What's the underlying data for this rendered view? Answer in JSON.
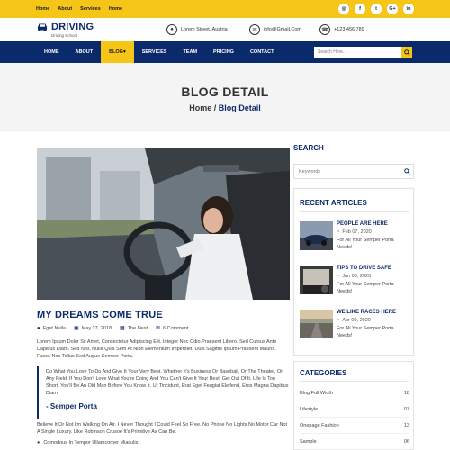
{
  "topbar": {
    "links": [
      "Home",
      "About",
      "Services",
      "Home"
    ],
    "social": [
      {
        "icon": "rss-icon",
        "glyph": "◎"
      },
      {
        "icon": "facebook-icon",
        "glyph": "f"
      },
      {
        "icon": "twitter-icon",
        "glyph": "t"
      },
      {
        "icon": "google-plus-icon",
        "glyph": "G+"
      },
      {
        "icon": "linkedin-icon",
        "glyph": "in"
      }
    ]
  },
  "header": {
    "brand": "DRIVING",
    "tagline": "Driving School",
    "address": "Lorem Street, Austria",
    "email": "info@Gmail.Com",
    "phone": "+123 456 789"
  },
  "nav": {
    "items": [
      "HOME",
      "ABOUT",
      "BLOG▾",
      "SERVICES",
      "TEAM",
      "PRICING",
      "CONTACT"
    ],
    "active_index": 2,
    "search_placeholder": "Search Here..."
  },
  "hero": {
    "title": "BLOG DETAIL",
    "crumb_home": "Home",
    "crumb_sep": " / ",
    "crumb_current": "Blog Detail"
  },
  "post": {
    "title": "MY DREAMS COME TRUE",
    "author": "Eget Nulla",
    "date": "May 27, 2018",
    "category": "The Nest",
    "comments": "6 Comment",
    "intro": "Lorem Ipsum Dolor Sit Amet, Consectetur Adipiscing Elit. Integer Nec Odio.Praesent Libero. Sed Cursus Ante Dapibus Diam. Sed Nisi. Nulla Quis Sem At Nibh Elementum Imperdiet. Duis Sagittis Ipsum.Praesent Mauris. Fusce Nec Tellus Sed Augue Semper Porta.",
    "quote": "Do What You Love To Do And Give It Your Very Best. Whether It's Business Or Baseball, Or The Theater, Or Any Field. If You Don't Love What You're Doing And You Can't Give It Your Best, Get Out Of It. Life Is Too Short. You'll Be An Old Man Before You Know It. Ut Tincidunt, Erat Eget Feugiat Eleifend, Eros Magna Dapibus Diam.",
    "quote_author": "- Semper Porta",
    "body": "Believe It Or Not I'm Walking On Air. I Never Thought I Could Feel So Free. No Phone No Lights No Motor Car Not A Single Luxury. Like Robinson Crusoe It's Primitive As Can Be.",
    "bullet": "Comodous In Tempor Ullamcorper Miaculis."
  },
  "sidebar": {
    "search_title": "SEARCH",
    "search_placeholder": "Keywords",
    "recent_title": "RECENT ARTICLES",
    "articles": [
      {
        "title": "PEOPLE ARE HERE",
        "date": "Feb 07, 2020",
        "excerpt": "For All Your Semper Porta Needs!"
      },
      {
        "title": "TIPS TO DRIVE SAFE",
        "date": "Jan 03, 2020",
        "excerpt": "For All Your Semper Porta Needs!"
      },
      {
        "title": "WE LIKE RACES HERE",
        "date": "Apr 09, 2020",
        "excerpt": "For All Your Semper Porta Needs!"
      }
    ],
    "categories_title": "CATEGORIES",
    "categories": [
      {
        "name": "Blog Full Width",
        "count": "18"
      },
      {
        "name": "Lifestyle",
        "count": "07"
      },
      {
        "name": "Onepage Fashion",
        "count": "13"
      },
      {
        "name": "Sample",
        "count": "06"
      }
    ]
  },
  "colors": {
    "accent": "#f5c518",
    "brand": "#0b2a6b"
  }
}
